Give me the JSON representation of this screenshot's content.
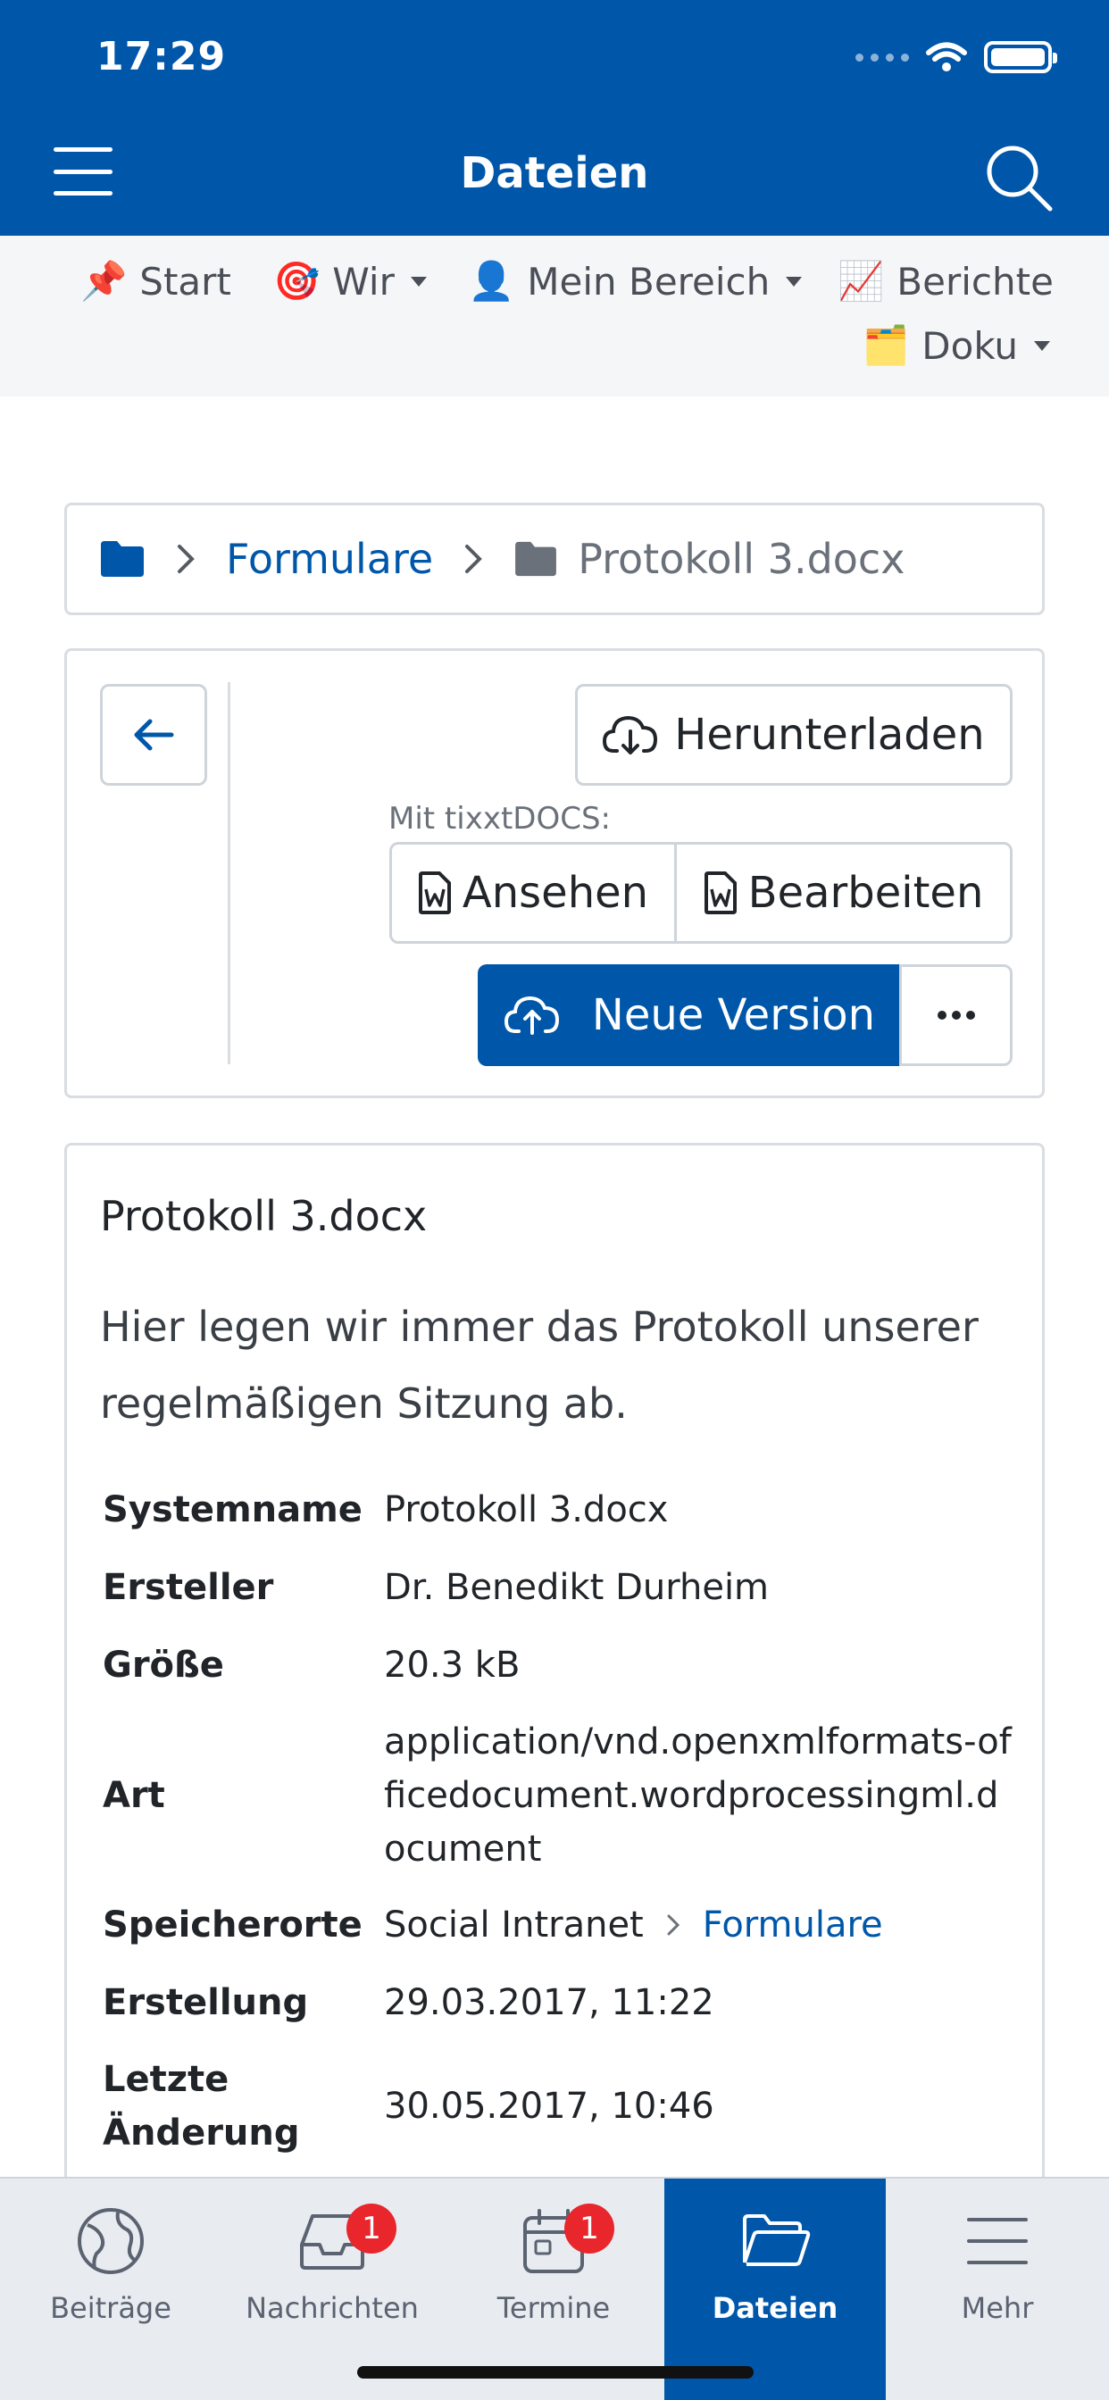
{
  "status": {
    "time": "17:29"
  },
  "header": {
    "title": "Dateien"
  },
  "topnav": {
    "items": [
      {
        "emoji": "📌",
        "label": "Start"
      },
      {
        "emoji": "🎯",
        "label": "Wir"
      },
      {
        "emoji": "👤",
        "label": "Mein Bereich"
      },
      {
        "emoji": "📈",
        "label": "Berichte"
      },
      {
        "emoji": "🗂️",
        "label": "Doku"
      }
    ]
  },
  "breadcrumb": {
    "folder": "Formulare",
    "file": "Protokoll 3.docx"
  },
  "actions": {
    "download": "Herunterladen",
    "tixxt_label": "Mit tixxtDOCS:",
    "view": "Ansehen",
    "edit": "Bearbeiten",
    "new_version": "Neue Version"
  },
  "details": {
    "title": "Protokoll 3.docx",
    "description": "Hier legen wir immer das Protokoll unserer regelmäßigen Sitzung ab.",
    "rows": {
      "systemname": {
        "label": "Systemname",
        "value": "Protokoll 3.docx"
      },
      "creator": {
        "label": "Ersteller",
        "value": "Dr. Benedikt Durheim"
      },
      "size": {
        "label": "Größe",
        "value": "20.3 kB"
      },
      "type": {
        "label": "Art",
        "value": "application/vnd.openxmlformats-officedocument.wordprocessingml.document"
      },
      "location": {
        "label": "Speicherorte",
        "root": "Social Intranet",
        "folder": "Formulare"
      },
      "created": {
        "label": "Erstellung",
        "value": "29.03.2017, 11:22"
      },
      "modified": {
        "label": "Letzte Änderung",
        "value": "30.05.2017, 10:46"
      }
    }
  },
  "tabbar": {
    "tabs": [
      {
        "label": "Beiträge"
      },
      {
        "label": "Nachrichten",
        "badge": "1"
      },
      {
        "label": "Termine",
        "badge": "1"
      },
      {
        "label": "Dateien"
      },
      {
        "label": "Mehr"
      }
    ]
  },
  "colors": {
    "primary": "#0057aa",
    "badge": "#e8262c",
    "border": "#d9dde2"
  }
}
